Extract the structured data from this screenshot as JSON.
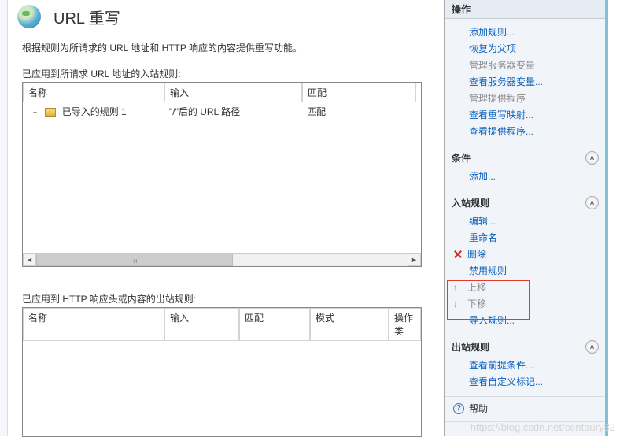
{
  "header": {
    "title": "URL 重写"
  },
  "description": "根据规则为所请求的 URL 地址和 HTTP 响应的内容提供重写功能。",
  "inbound": {
    "label": "已应用到所请求 URL 地址的入站规则:",
    "columns": {
      "name": "名称",
      "input": "输入",
      "match": "匹配"
    },
    "rows": [
      {
        "name": "已导入的规则 1",
        "input": "\"/\"后的 URL 路径",
        "match": "匹配"
      }
    ]
  },
  "outbound": {
    "label": "已应用到 HTTP 响应头或内容的出站规则:",
    "columns": {
      "name": "名称",
      "input": "输入",
      "match": "匹配",
      "mode": "模式",
      "action": "操作类"
    }
  },
  "panel": {
    "title": "操作",
    "ops": {
      "add_rule": "添加规则...",
      "restore_parent": "恢复为父项",
      "manage_vars": "管理服务器变量",
      "view_vars": "查看服务器变量...",
      "manage_providers": "管理提供程序",
      "view_rewrite_maps": "查看重写映射...",
      "view_providers": "查看提供程序..."
    },
    "conditions": {
      "title": "条件",
      "add": "添加..."
    },
    "inbound_rules": {
      "title": "入站规则",
      "edit": "编辑...",
      "rename": "重命名",
      "delete": "删除",
      "disable": "禁用规则",
      "move_up": "上移",
      "move_down": "下移",
      "import": "导入规则..."
    },
    "outbound_rules": {
      "title": "出站规则",
      "preconditions": "查看前提条件...",
      "custom_tags": "查看自定义标记..."
    },
    "help": "帮助"
  },
  "watermark": "https://blog.csdn.net/centaury32"
}
